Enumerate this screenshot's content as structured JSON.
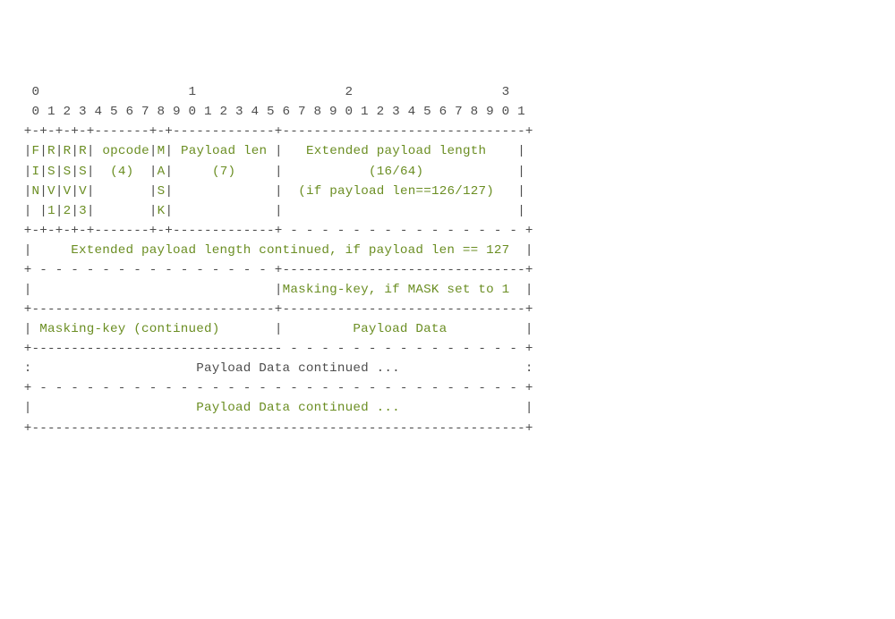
{
  "diagram": {
    "header": {
      "tens_row": "  0                   1                   2                   3",
      "bits_row": "  0 1 2 3 4 5 6 7 8 9 0 1 2 3 4 5 6 7 8 9 0 1 2 3 4 5 6 7 8 9 0 1"
    },
    "sep": {
      "top": " +-+-+-+-+-------+-+-------------+-------------------------------+",
      "after_bits": " +-+-+-+-+-------+-+-------------+ - - - - - - - - - - - - - - - +",
      "before_mask": " + - - - - - - - - - - - - - - - +-------------------------------+",
      "full": " +-------------------------------+-------------------------------+",
      "dashed_full": " + - - - - - - - - - - - - - - - - - - - - - - - - - - - - - - - +",
      "bottom": " +---------------------------------------------------------------+",
      "long_dash": " +-------------------------------- - - - - - - - - - - - - - - - +"
    },
    "row1_bits": {
      "bit0": "F",
      "bit1": "R",
      "bit2": "R",
      "bit3": "R",
      "opcode": " opcode",
      "mask": "M",
      "paylen": " Payload len ",
      "ext": "   Extended payload length    "
    },
    "row2_bits": {
      "bit0": "I",
      "bit1": "S",
      "bit2": "S",
      "bit3": "S",
      "opcode": "  (4)  ",
      "mask": "A",
      "paylen": "     (7)     ",
      "ext": "           (16/64)            "
    },
    "row3_bits": {
      "bit0": "N",
      "bit1": "V",
      "bit2": "V",
      "bit3": "V",
      "opcode": "       ",
      "mask": "S",
      "paylen": "             ",
      "ext": "  (if payload len==126/127)   "
    },
    "row4_bits": {
      "bit0": " ",
      "bit1": "1",
      "bit2": "2",
      "bit3": "3",
      "opcode": "       ",
      "mask": "K",
      "paylen": "             ",
      "ext": "                              "
    },
    "ext_cont": "     Extended payload length continued, if payload len == 127  ",
    "maskkey_row_left": "                               ",
    "maskkey_row_right": "Masking-key, if MASK set to 1  ",
    "mk_cont_left": " Masking-key (continued)       ",
    "payload_right": "         Payload Data          ",
    "payload_cont_1": "                     Payload Data continued ...                ",
    "payload_cont_2": "                     Payload Data continued ...                "
  }
}
